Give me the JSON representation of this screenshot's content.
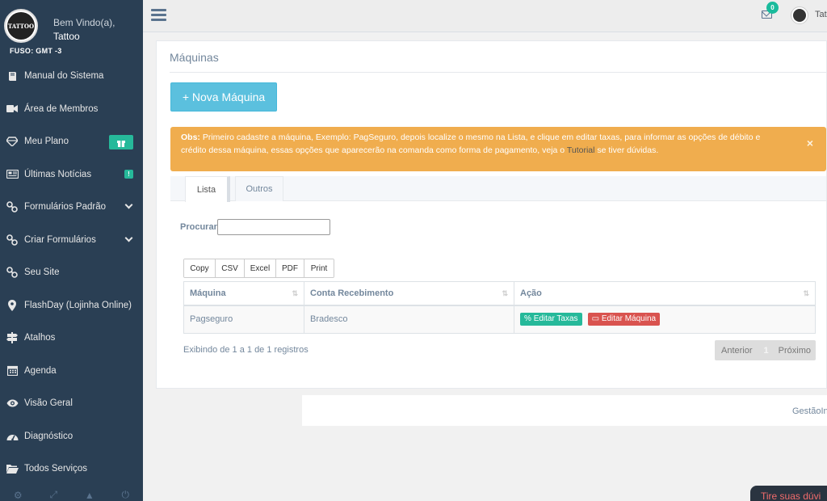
{
  "sidebar": {
    "welcome": "Bem Vindo(a),",
    "username": "Tattoo",
    "logo_text": "TATTOO",
    "timezone": "FUSO: GMT -3",
    "items": [
      {
        "label": "Manual do Sistema",
        "icon": "book-icon"
      },
      {
        "label": "Área de Membros",
        "icon": "video-icon"
      },
      {
        "label": "Meu Plano",
        "icon": "diamond-icon"
      },
      {
        "label": "Últimas Notícias",
        "icon": "newspaper-icon"
      },
      {
        "label": "Formulários Padrão",
        "icon": "link-icon"
      },
      {
        "label": "Criar Formulários",
        "icon": "link-icon"
      },
      {
        "label": "Seu Site",
        "icon": "link-icon"
      },
      {
        "label": "FlashDay (Lojinha Online)",
        "icon": "map-marker-icon"
      },
      {
        "label": "Atalhos",
        "icon": "signpost-icon"
      },
      {
        "label": "Agenda",
        "icon": "calendar-icon"
      },
      {
        "label": "Visão Geral",
        "icon": "eye-icon"
      },
      {
        "label": "Diagnóstico",
        "icon": "dashboard-icon"
      },
      {
        "label": "Todos Serviços",
        "icon": "folder-icon"
      }
    ]
  },
  "topbar": {
    "notifications": "0",
    "user": "Tat"
  },
  "page": {
    "title": "Máquinas",
    "new_button": "+ Nova Máquina",
    "alert": {
      "label": "Obs:",
      "text_before": "Primeiro cadastre a máquina, Exemplo: PagSeguro, depois localize o mesmo na Lista, e clique em editar taxas, para informar as opções de débito e crédito dessa máquina, essas opções que aparecerão na comanda como forma de pagamento, veja o",
      "link": "Tutorial",
      "text_after": "se tiver dúvidas.",
      "close": "×"
    },
    "tabs": [
      "Lista",
      "Outros"
    ],
    "search_label": "Procurar",
    "export_buttons": [
      "Copy",
      "CSV",
      "Excel",
      "PDF",
      "Print"
    ],
    "table": {
      "headers": [
        "Máquina",
        "Conta Recebimento",
        "Ação"
      ],
      "rows": [
        {
          "maquina": "Pagseguro",
          "conta": "Bradesco",
          "btn_taxas": "Editar Taxas",
          "btn_maquina": "Editar Máquina"
        }
      ]
    },
    "info": "Exibindo de 1 a 1 de 1 registros",
    "pager": {
      "prev": "Anterior",
      "current": "1",
      "next": "Próximo"
    }
  },
  "footer": {
    "text": "GestãoInk"
  },
  "help_button": "Tire suas dúvi"
}
